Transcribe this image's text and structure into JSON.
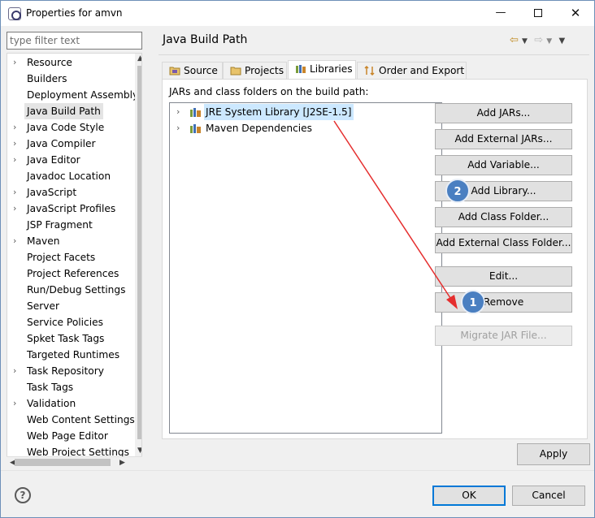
{
  "window": {
    "title": "Properties for amvn",
    "min_glyph": "—",
    "close_glyph": "✕"
  },
  "filter": {
    "placeholder": "type filter text",
    "value": ""
  },
  "nav": {
    "items": [
      {
        "label": "Resource",
        "expandable": true
      },
      {
        "label": "Builders",
        "expandable": false
      },
      {
        "label": "Deployment Assembly",
        "expandable": false
      },
      {
        "label": "Java Build Path",
        "expandable": false,
        "selected": true
      },
      {
        "label": "Java Code Style",
        "expandable": true
      },
      {
        "label": "Java Compiler",
        "expandable": true
      },
      {
        "label": "Java Editor",
        "expandable": true
      },
      {
        "label": "Javadoc Location",
        "expandable": false
      },
      {
        "label": "JavaScript",
        "expandable": true
      },
      {
        "label": "JavaScript Profiles",
        "expandable": true
      },
      {
        "label": "JSP Fragment",
        "expandable": false
      },
      {
        "label": "Maven",
        "expandable": true
      },
      {
        "label": "Project Facets",
        "expandable": false
      },
      {
        "label": "Project References",
        "expandable": false
      },
      {
        "label": "Run/Debug Settings",
        "expandable": false
      },
      {
        "label": "Server",
        "expandable": false
      },
      {
        "label": "Service Policies",
        "expandable": false
      },
      {
        "label": "Spket Task Tags",
        "expandable": false
      },
      {
        "label": "Targeted Runtimes",
        "expandable": false
      },
      {
        "label": "Task Repository",
        "expandable": true
      },
      {
        "label": "Task Tags",
        "expandable": false
      },
      {
        "label": "Validation",
        "expandable": true
      },
      {
        "label": "Web Content Settings",
        "expandable": false
      },
      {
        "label": "Web Page Editor",
        "expandable": false
      },
      {
        "label": "Web Project Settings",
        "expandable": false
      }
    ]
  },
  "page": {
    "title": "Java Build Path"
  },
  "tabs": [
    {
      "label": "Source"
    },
    {
      "label": "Projects"
    },
    {
      "label": "Libraries",
      "active": true
    },
    {
      "label": "Order and Export"
    }
  ],
  "libraries": {
    "caption": "JARs and class folders on the build path:",
    "items": [
      {
        "label": "JRE System Library [J2SE-1.5]",
        "selected": true
      },
      {
        "label": "Maven Dependencies",
        "selected": false
      }
    ]
  },
  "buttons": {
    "add_jars": "Add JARs...",
    "add_external_jars": "Add External JARs...",
    "add_variable": "Add Variable...",
    "add_library": "Add Library...",
    "add_class_folder": "Add Class Folder...",
    "add_external_class_folder": "Add External Class Folder...",
    "edit": "Edit...",
    "remove": "Remove",
    "migrate_jar": "Migrate JAR File...",
    "apply": "Apply",
    "ok": "OK",
    "cancel": "Cancel"
  },
  "markers": {
    "remove_marker": "1",
    "add_library_marker": "2"
  },
  "icons": {
    "app": "eclipse-properties-icon",
    "help": "help-icon",
    "nav_back": "back-arrow-icon",
    "nav_forward": "forward-arrow-icon",
    "menu": "view-menu-icon"
  },
  "colors": {
    "accent": "#0078d7",
    "marker": "#4a7fc1",
    "annotation_arrow": "#e52e2e",
    "selection": "#cce8ff"
  }
}
